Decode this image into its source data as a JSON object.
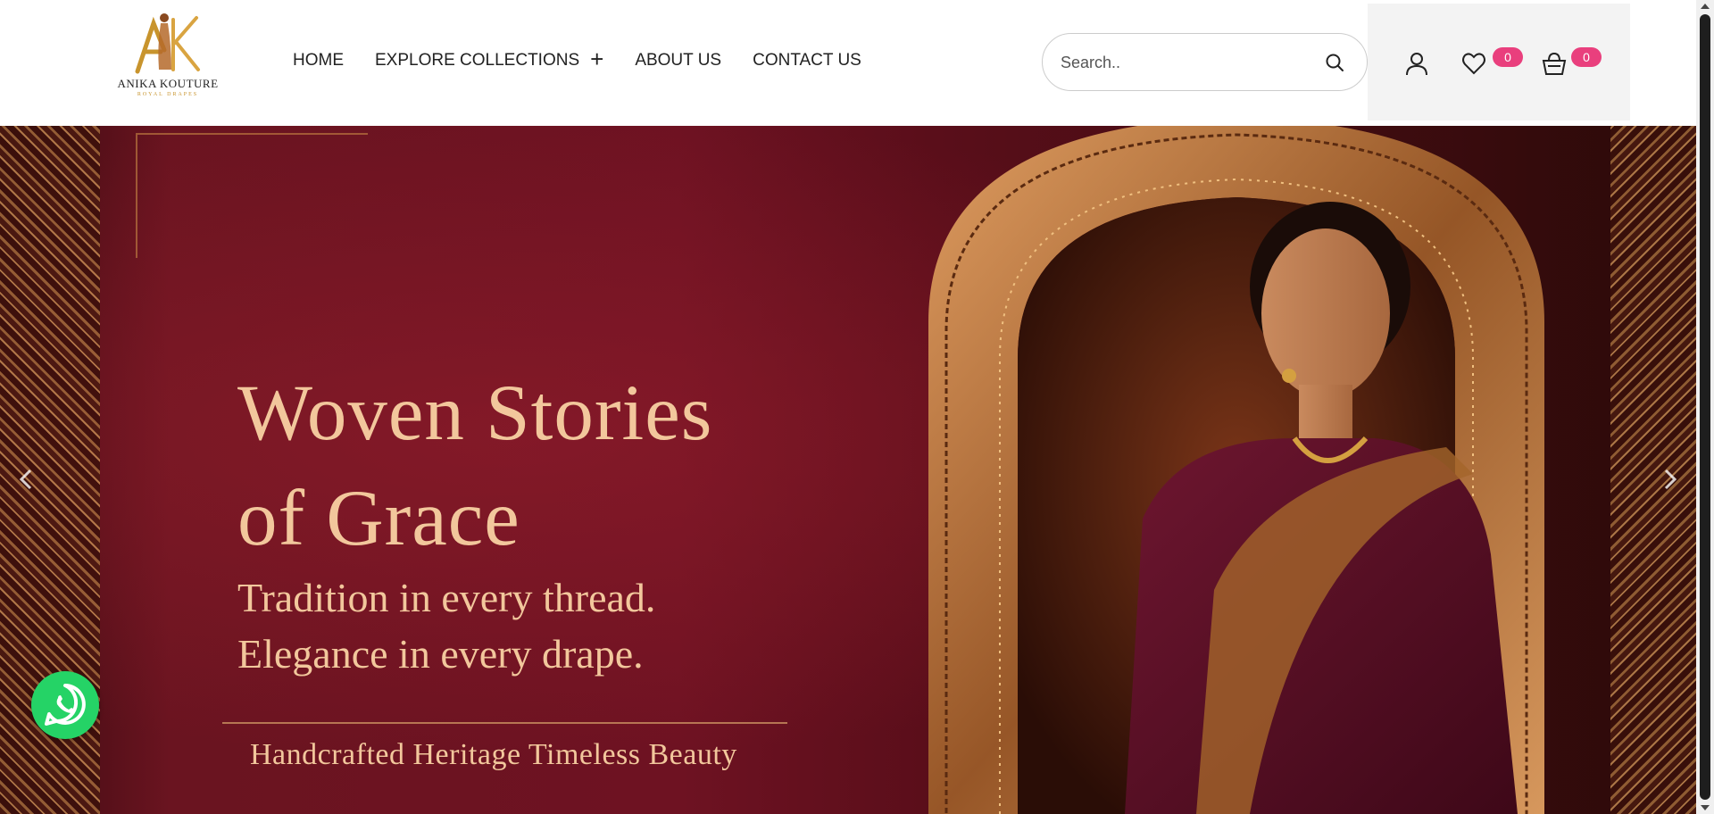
{
  "brand": {
    "name": "ANIKA KOUTURE",
    "tagline": "ROYAL DRAPES",
    "colors": {
      "gold": "#c8942d",
      "badge": "#e93f7d",
      "whatsapp": "#25d366"
    }
  },
  "nav": {
    "items": [
      {
        "label": "HOME"
      },
      {
        "label": "EXPLORE COLLECTIONS",
        "icon": "plus-icon"
      },
      {
        "label": "ABOUT US"
      },
      {
        "label": "CONTACT US"
      }
    ]
  },
  "search": {
    "placeholder": "Search..",
    "value": ""
  },
  "header_actions": {
    "account_icon": "user-icon",
    "wishlist": {
      "icon": "heart-icon",
      "count": "0"
    },
    "cart": {
      "icon": "basket-icon",
      "count": "0"
    }
  },
  "hero": {
    "title_line1": "Woven Stories",
    "title_line2": "of Grace",
    "subtitle_line1": "Tradition in every thread.",
    "subtitle_line2": "Elegance in every drape.",
    "tagline": "Handcrafted Heritage Timeless Beauty",
    "prev_icon": "chevron-left-icon",
    "next_icon": "chevron-right-icon"
  },
  "floating": {
    "whatsapp_icon": "whatsapp-icon"
  }
}
